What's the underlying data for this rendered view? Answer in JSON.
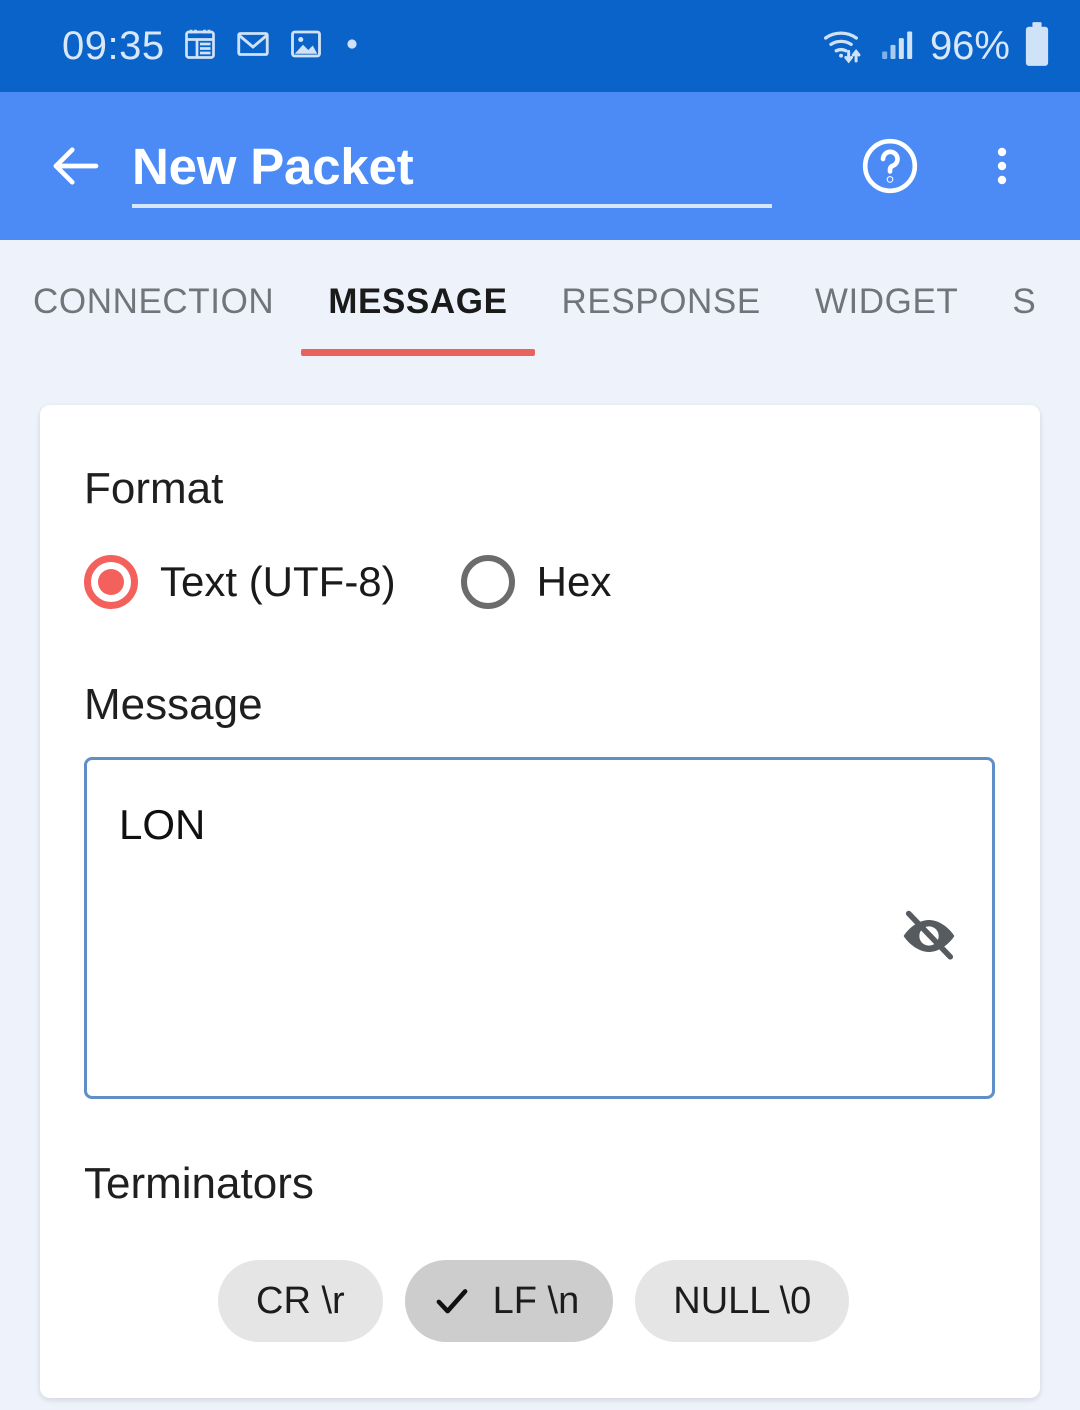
{
  "status_bar": {
    "time": "09:35",
    "battery_text": "96%",
    "icons": [
      "calendar-icon",
      "mail-icon",
      "image-icon",
      "dot-icon",
      "wifi-icon",
      "signal-icon",
      "battery-icon"
    ],
    "background_color": "#0a63c9",
    "foreground_color": "#d9e7f8"
  },
  "app_bar": {
    "title": "New Packet",
    "back_icon": "back-arrow-icon",
    "help_icon": "help-circle-icon",
    "overflow_icon": "more-vertical-icon",
    "background_color": "#4c8bf5"
  },
  "tabs": {
    "active_index": 1,
    "accent_color": "#e8635d",
    "items": [
      {
        "label": "CONNECTION"
      },
      {
        "label": "MESSAGE"
      },
      {
        "label": "RESPONSE"
      },
      {
        "label": "WIDGET"
      },
      {
        "label": "S"
      }
    ]
  },
  "message_tab": {
    "format": {
      "label": "Format",
      "selected": "Text (UTF-8)",
      "options": [
        {
          "label": "Text (UTF-8)",
          "selected": true
        },
        {
          "label": "Hex",
          "selected": false
        }
      ],
      "selected_color": "#f4605b",
      "unselected_color": "#6c6c6c"
    },
    "message": {
      "label": "Message",
      "value": "LON",
      "placeholder": "",
      "border_color": "#5e8fc6",
      "visibility_toggle_icon": "eye-off-icon"
    },
    "terminators": {
      "label": "Terminators",
      "chips": [
        {
          "label": "CR \\r",
          "selected": false
        },
        {
          "label": "LF \\n",
          "selected": true
        },
        {
          "label": "NULL \\0",
          "selected": false
        }
      ],
      "selected_background": "#cdcdcd",
      "unselected_background": "#e5e5e5",
      "check_icon": "check-icon"
    }
  },
  "page": {
    "background_color": "#eef3fb",
    "card_color": "#ffffff"
  }
}
